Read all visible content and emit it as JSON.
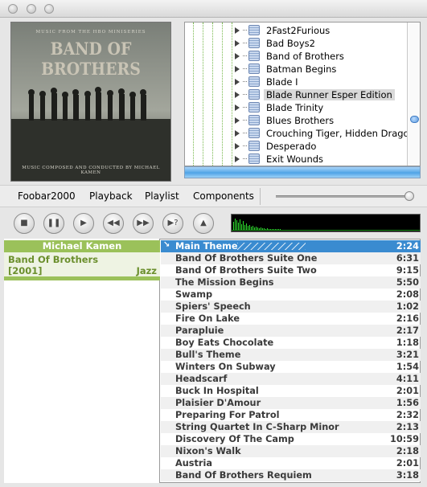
{
  "window": {
    "buttons": [
      "close",
      "minimize",
      "zoom"
    ]
  },
  "album_art": {
    "top_text": "MUSIC FROM THE HBO MINISERIES",
    "title": "BAND OF BROTHERS",
    "bottom_text": "MUSIC COMPOSED AND CONDUCTED BY MICHAEL KAMEN"
  },
  "library": {
    "items": [
      "2Fast2Furious",
      "Bad Boys2",
      "Band of Brothers",
      "Batman Begins",
      "Blade I",
      "Blade Runner Esper Edition",
      "Blade Trinity",
      "Blues Brothers",
      "Crouching Tiger, Hidden Dragon",
      "Desperado",
      "Exit Wounds"
    ],
    "selected": "Blade Runner Esper Edition"
  },
  "menu": {
    "items": [
      "Foobar2000",
      "Playback",
      "Playlist",
      "Components"
    ]
  },
  "volume": {
    "level": 0.95
  },
  "transport": {
    "buttons": [
      "stop",
      "pause",
      "play",
      "previous",
      "next",
      "random",
      "eject"
    ]
  },
  "album_panel": {
    "artist": "Michael Kamen",
    "album": "Band Of Brothers",
    "year": "[2001]",
    "genre": "Jazz"
  },
  "playlist": {
    "tracks": [
      {
        "title": "Main Theme",
        "duration": "2:24",
        "playing": true
      },
      {
        "title": "Band Of Brothers Suite One",
        "duration": "6:31"
      },
      {
        "title": "Band Of Brothers Suite Two",
        "duration": "9:15"
      },
      {
        "title": "The Mission Begins",
        "duration": "5:50"
      },
      {
        "title": "Swamp",
        "duration": "2:08"
      },
      {
        "title": "Spiers' Speech",
        "duration": "1:02"
      },
      {
        "title": "Fire On Lake",
        "duration": "2:16"
      },
      {
        "title": "Parapluie",
        "duration": "2:17"
      },
      {
        "title": "Boy Eats Chocolate",
        "duration": "1:18"
      },
      {
        "title": "Bull's Theme",
        "duration": "3:21"
      },
      {
        "title": "Winters On Subway",
        "duration": "1:54"
      },
      {
        "title": "Headscarf",
        "duration": "4:11"
      },
      {
        "title": "Buck In Hospital",
        "duration": "2:01"
      },
      {
        "title": "Plaisier D'Amour",
        "duration": "1:56"
      },
      {
        "title": "Preparing For Patrol",
        "duration": "2:32"
      },
      {
        "title": "String Quartet In C-Sharp Minor",
        "duration": "2:13"
      },
      {
        "title": "Discovery Of The Camp",
        "duration": "10:59"
      },
      {
        "title": "Nixon's Walk",
        "duration": "2:18"
      },
      {
        "title": "Austria",
        "duration": "2:01"
      },
      {
        "title": "Band Of Brothers Requiem",
        "duration": "3:18"
      }
    ]
  },
  "colors": {
    "accent_green": "#9bc15a",
    "playing_blue": "#3a8bd0",
    "spectrum_green": "#2ee02e"
  }
}
